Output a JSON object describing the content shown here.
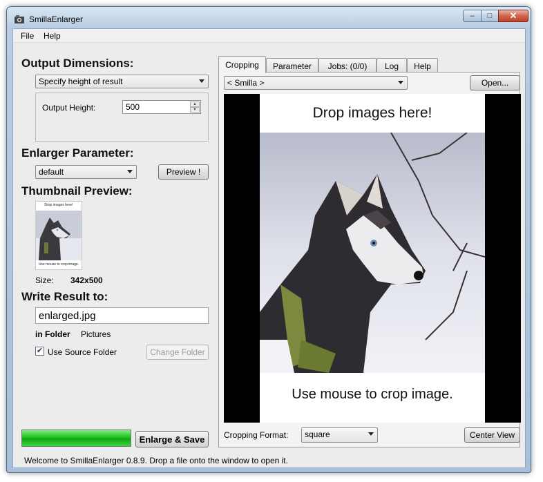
{
  "window": {
    "title": "SmillaEnlarger"
  },
  "menu": {
    "items": [
      "File",
      "Help"
    ]
  },
  "left": {
    "output_dimensions": {
      "title": "Output Dimensions:",
      "mode": "Specify height of result",
      "height_label": "Output Height:",
      "height_value": "500"
    },
    "enlarger": {
      "title": "Enlarger Parameter:",
      "preset": "default",
      "preview_button": "Preview !"
    },
    "thumbnail": {
      "title": "Thumbnail Preview:",
      "thumb_top_text": "Drop images here!",
      "thumb_bottom_text": "Use mouse to crop image.",
      "size_label": "Size:",
      "size_value": "342x500"
    },
    "write_result": {
      "title": "Write Result to:",
      "filename": "enlarged.jpg",
      "folder_label": "in Folder",
      "folder_value": "Pictures",
      "use_source_label": "Use Source Folder",
      "use_source_checked": true,
      "change_folder_button": "Change Folder"
    },
    "progress": {
      "fraction": 1.0,
      "color": "#20c020"
    },
    "enlarge_button": "Enlarge & Save"
  },
  "right": {
    "tabs": [
      "Cropping",
      "Parameter",
      "Jobs: (0/0)",
      "Log",
      "Help"
    ],
    "active_tab": "Cropping",
    "source_combo": "< Smilla >",
    "open_button": "Open...",
    "viewer": {
      "drop_text": "Drop images here!",
      "crop_text": "Use mouse to crop image."
    },
    "cropping_format_label": "Cropping Format:",
    "cropping_format_value": "square",
    "center_view_button": "Center View"
  },
  "status": "Welcome to SmillaEnlarger 0.8.9.  Drop a file onto the window to open it.",
  "icons": [
    "app-icon",
    "minimize-icon",
    "maximize-icon",
    "close-icon",
    "dropdown-arrow-icon",
    "spin-up-icon",
    "spin-down-icon",
    "checkmark-icon"
  ],
  "colors": {
    "progress": "#20c020",
    "title_gradient": "#b9cde2",
    "close_button": "#c2422a"
  }
}
